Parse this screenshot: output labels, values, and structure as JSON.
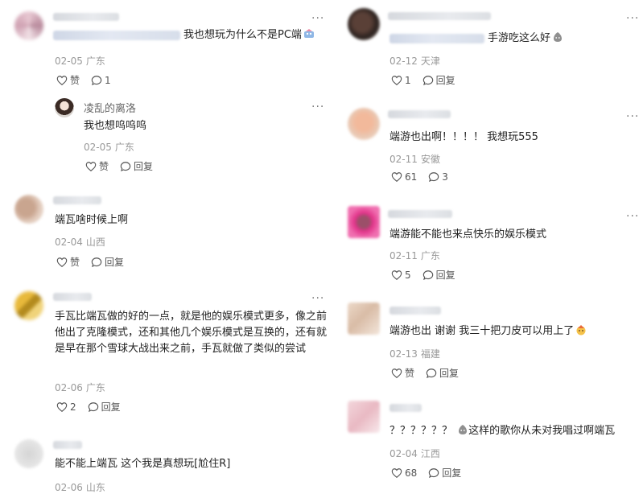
{
  "labels": {
    "like": "赞",
    "reply": "回复"
  },
  "left": {
    "c1": {
      "text": "我也想玩为什么不是PC端",
      "date": "02-05",
      "loc": "广东",
      "likes": "",
      "replies": "1",
      "reply": {
        "username": "凌乱的离洛",
        "text": "我也想呜呜呜",
        "date": "02-05",
        "loc": "广东"
      }
    },
    "c2": {
      "text": "端瓦啥时候上啊",
      "date": "02-04",
      "loc": "山西"
    },
    "c3": {
      "text": "手瓦比端瓦做的好的一点，就是他的娱乐模式更多，像之前他出了克隆模式，还和其他几个娱乐模式是互换的，还有就是早在那个雪球大战出来之前，手瓦就做了类似的尝试",
      "date": "02-06",
      "loc": "广东",
      "likes": "2"
    },
    "c4": {
      "text": "能不能上端瓦 这个我是真想玩[尬住R]",
      "date": "02-06",
      "loc": "山东"
    }
  },
  "right": {
    "c1": {
      "text": "手游吃这么好",
      "date": "02-12",
      "loc": "天津",
      "likes": "1"
    },
    "c2": {
      "text": "端游也出啊！！！！ 我想玩555",
      "date": "02-11",
      "loc": "安徽",
      "likes": "61",
      "replies": "3"
    },
    "c3": {
      "text": "端游能不能也来点快乐的娱乐模式",
      "date": "02-11",
      "loc": "广东",
      "likes": "5"
    },
    "c4": {
      "text": "端游也出 谢谢 我三十把刀皮可以用上了",
      "date": "02-13",
      "loc": "福建"
    },
    "c5": {
      "text_prefix": "？？？？？？",
      "text": "这样的歌你从未对我唱过啊端瓦",
      "date": "02-04",
      "loc": "江西",
      "likes": "68"
    }
  },
  "icons": {
    "more": "more-dots-icon",
    "like": "heart-outline-icon",
    "reply": "comment-bubble-icon"
  },
  "colors": {
    "meta": "#999999",
    "text": "#222222",
    "action": "#555555"
  }
}
